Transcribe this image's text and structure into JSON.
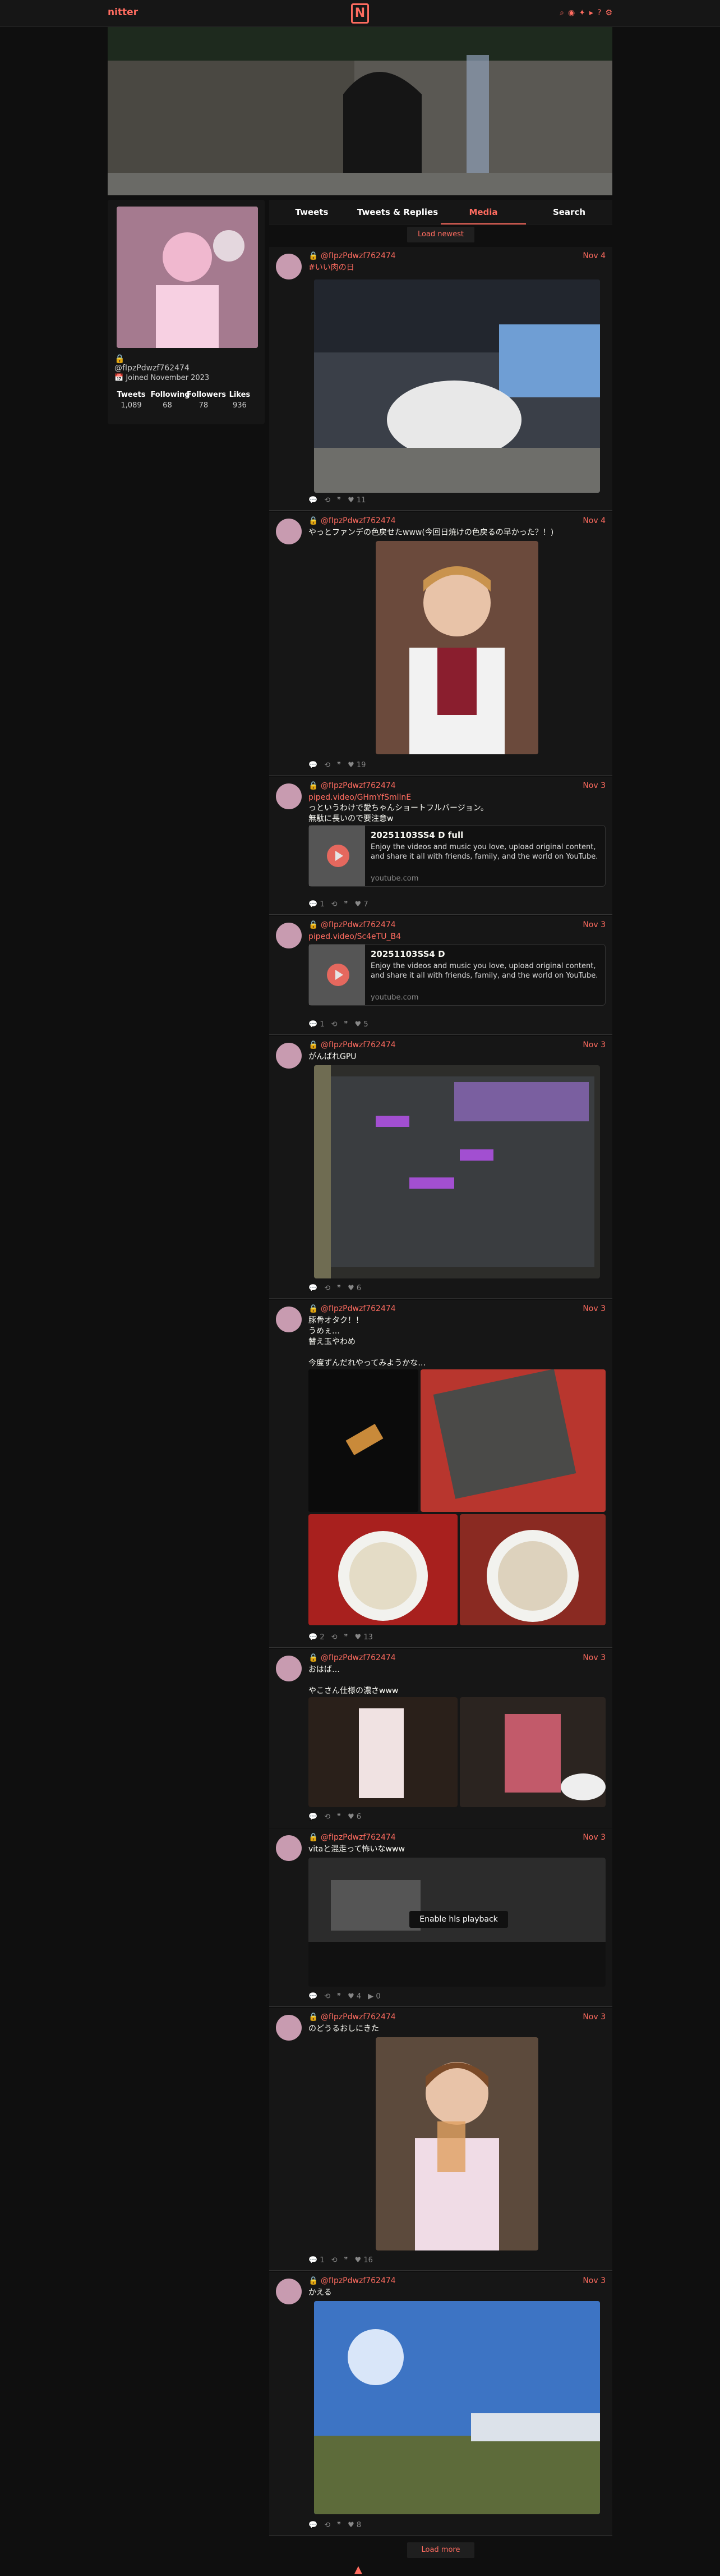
{
  "nav": {
    "brand": "nitter",
    "logo": "N",
    "icons": [
      "search-icon",
      "rss-icon",
      "twitter-icon",
      "tag-icon",
      "question-icon",
      "settings-icon"
    ]
  },
  "profile": {
    "name_icon": "lock-icon",
    "handle": "@fIpzPdwzf762474",
    "joined": "Joined November 2023",
    "stats": [
      {
        "label": "Tweets",
        "value": "1,089"
      },
      {
        "label": "Following",
        "value": "68"
      },
      {
        "label": "Followers",
        "value": "78"
      },
      {
        "label": "Likes",
        "value": "936"
      }
    ]
  },
  "tabs": [
    "Tweets",
    "Tweets & Replies",
    "Media",
    "Search"
  ],
  "active_tab": "Media",
  "load_newest": "Load newest",
  "load_more": "Load more",
  "enable_playback": "Enable hls playback",
  "tweets": [
    {
      "handle": "@fIpzPdwzf762474",
      "date": "Nov 4",
      "lines": [
        "#いい肉の日"
      ],
      "link": true,
      "stats": [
        "",
        "",
        "",
        "11"
      ]
    },
    {
      "handle": "@fIpzPdwzf762474",
      "date": "Nov 4",
      "lines": [
        "やっとファンデの色戻せたwww(今回日焼けの色戻るの早かった？！)"
      ],
      "link": false,
      "stats": [
        "",
        "",
        "",
        "19"
      ]
    },
    {
      "handle": "@fIpzPdwzf762474",
      "date": "Nov 3",
      "lines": [
        "piped.video/GHmYfSmllnE",
        "っというわけで愛ちゃんショートフルバージョン。",
        "無駄に長いので要注意w"
      ],
      "link": true,
      "card": {
        "title": "20251103SS4 D full",
        "desc": "Enjoy the videos and music you love, upload original content, and share it all with friends, family, and the world on YouTube.",
        "host": "youtube.com"
      },
      "stats": [
        "1",
        "",
        "",
        "7"
      ]
    },
    {
      "handle": "@fIpzPdwzf762474",
      "date": "Nov 3",
      "lines": [
        "piped.video/Sc4eTU_B4"
      ],
      "link": true,
      "card": {
        "title": "20251103SS4 D",
        "desc": "Enjoy the videos and music you love, upload original content, and share it all with friends, family, and the world on YouTube.",
        "host": "youtube.com"
      },
      "stats": [
        "1",
        "",
        "",
        "5"
      ]
    },
    {
      "handle": "@fIpzPdwzf762474",
      "date": "Nov 3",
      "lines": [
        "がんばれGPU"
      ],
      "link": false,
      "stats": [
        "",
        "",
        "",
        "6"
      ]
    },
    {
      "handle": "@fIpzPdwzf762474",
      "date": "Nov 3",
      "lines": [
        "豚骨オタク！！",
        "うめぇ…",
        "替え玉やわめ",
        "",
        "今度ずんだれやってみようかな…"
      ],
      "link": false,
      "stats": [
        "2",
        "",
        "",
        "13"
      ]
    },
    {
      "handle": "@fIpzPdwzf762474",
      "date": "Nov 3",
      "lines": [
        "おはば…",
        "",
        "やこさん仕様の濃さwww"
      ],
      "link": false,
      "stats": [
        "",
        "",
        "",
        "6"
      ]
    },
    {
      "handle": "@fIpzPdwzf762474",
      "date": "Nov 3",
      "lines": [
        "vitaと混走って怖いなwww"
      ],
      "link": false,
      "stats": [
        "",
        "",
        "4",
        "0"
      ]
    },
    {
      "handle": "@fIpzPdwzf762474",
      "date": "Nov 3",
      "lines": [
        "のどうるおしにきた"
      ],
      "link": false,
      "stats": [
        "1",
        "",
        "",
        "16"
      ]
    },
    {
      "handle": "@fIpzPdwzf762474",
      "date": "Nov 3",
      "lines": [
        "かえる"
      ],
      "link": false,
      "stats": [
        "",
        "",
        "",
        "8"
      ]
    }
  ],
  "colors": {
    "accent": "#ff6c60",
    "bg": "#0f0f0f",
    "panel": "#161616"
  }
}
